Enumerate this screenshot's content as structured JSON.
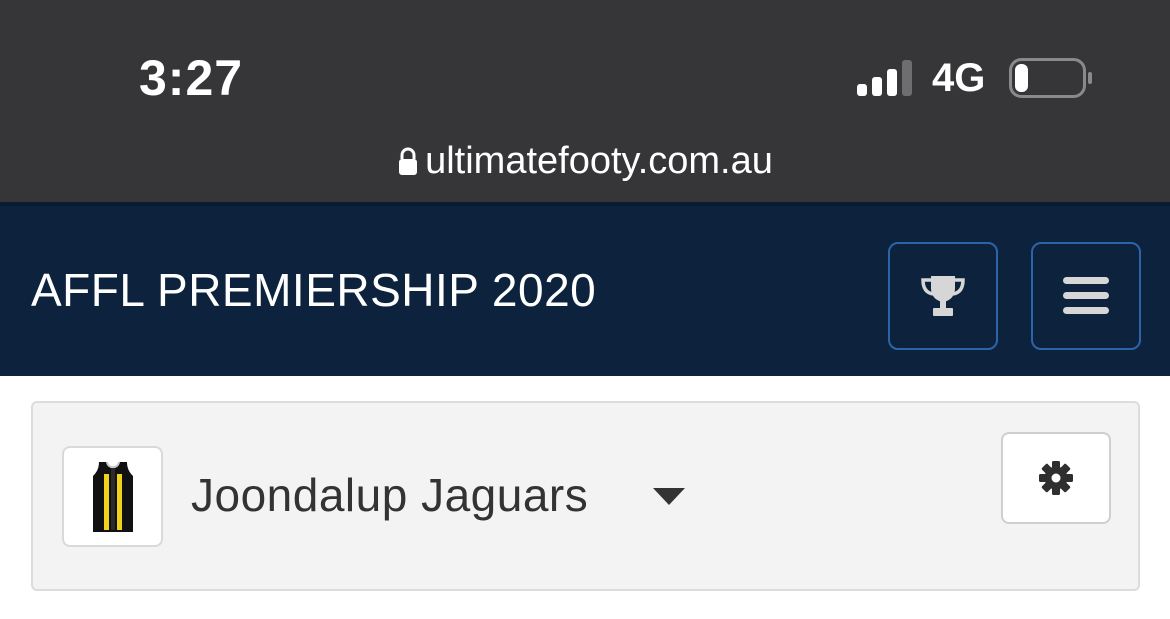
{
  "status_bar": {
    "time": "3:27",
    "network": "4G",
    "signal_bars": 4,
    "signal_bars_active": 3,
    "battery_level": 0.2
  },
  "url_bar": {
    "url": "ultimatefooty.com.au",
    "icon": "lock-icon"
  },
  "navbar": {
    "brand": "AFFL PREMIERSHIP 2020",
    "background": "#0c223d",
    "button_border": "#2d63a8",
    "trophy_icon": "trophy-icon",
    "menu_icon": "hamburger-menu-icon"
  },
  "team_card": {
    "team_name": "Joondalup Jaguars",
    "guernsey_icon": "guernsey-icon",
    "guernsey_colors": [
      "#111111",
      "#f2d21b"
    ],
    "dropdown_icon": "caret-down-icon",
    "settings_icon": "gear-icon"
  }
}
